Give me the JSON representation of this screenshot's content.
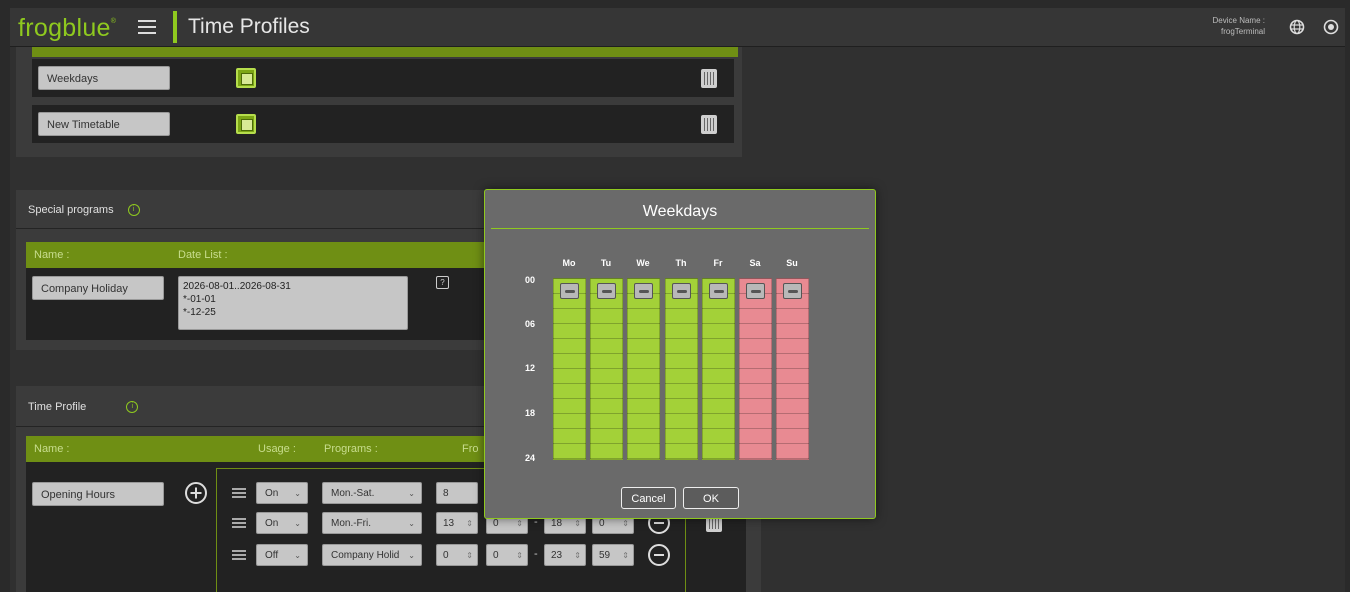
{
  "header": {
    "logo": "frogblue",
    "logo_mark": "®",
    "title": "Time Profiles",
    "device_label": "Device Name :",
    "device_name": "frogTerminal"
  },
  "timetables": {
    "items": [
      {
        "name": "Weekdays"
      },
      {
        "name": "New Timetable"
      }
    ]
  },
  "special_programs": {
    "title": "Special programs",
    "col_name": "Name :",
    "col_dates": "Date List :",
    "item": {
      "name": "Company Holiday",
      "dates": [
        "2026-08-01..2026-08-31",
        "*-01-01",
        "*-12-25"
      ],
      "help": "?"
    }
  },
  "time_profile": {
    "title": "Time Profile",
    "col_name": "Name :",
    "col_usage": "Usage :",
    "col_programs": "Programs :",
    "col_from": "Fro",
    "profile_name": "Opening Hours",
    "rows": [
      {
        "usage": "On",
        "program": "Mon.-Sat.",
        "h1": "8",
        "m1": "",
        "h2": "",
        "m2": "",
        "sep": ""
      },
      {
        "usage": "On",
        "program": "Mon.-Fri.",
        "h1": "13",
        "m1": "0",
        "h2": "18",
        "m2": "0",
        "sep": "-"
      },
      {
        "usage": "Off",
        "program": "Company Holid",
        "h1": "0",
        "m1": "0",
        "h2": "23",
        "m2": "59",
        "sep": "-"
      }
    ]
  },
  "modal": {
    "title": "Weekdays",
    "days": [
      {
        "label": "Mo",
        "active": true
      },
      {
        "label": "Tu",
        "active": true
      },
      {
        "label": "We",
        "active": true
      },
      {
        "label": "Th",
        "active": true
      },
      {
        "label": "Fr",
        "active": true
      },
      {
        "label": "Sa",
        "active": false
      },
      {
        "label": "Su",
        "active": false
      }
    ],
    "hours": [
      "00",
      "06",
      "12",
      "18",
      "24"
    ],
    "cancel": "Cancel",
    "ok": "OK"
  },
  "colors": {
    "accent": "#8fc91f",
    "active_day": "#a3d138",
    "inactive_day": "#e88a92"
  }
}
